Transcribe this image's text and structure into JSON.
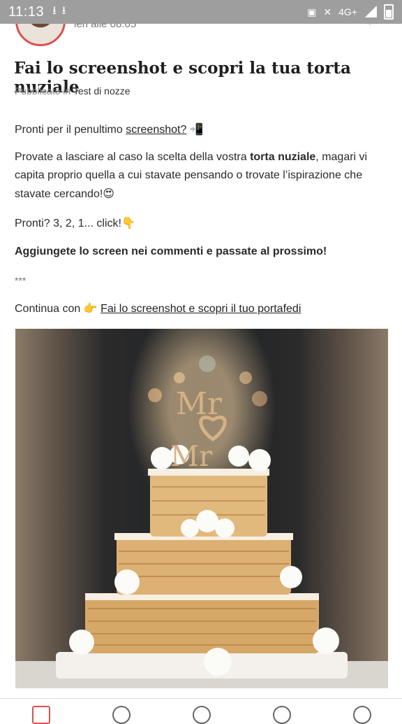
{
  "status_bar": {
    "time": "11:13",
    "network": "4G+",
    "left_icons": [
      "download-icon",
      "download-icon"
    ],
    "right_icons": [
      "nfc-icon",
      "mute-icon",
      "signal-icon",
      "battery-icon"
    ]
  },
  "post": {
    "time": "ieri alle 08:05",
    "title": "Fai lo screenshot e scopri la tua torta nuziale",
    "published_prefix": "Pubblicato in",
    "category": "Test di nozze",
    "p1_text": "Pronti per il penultimo ",
    "p1_link": "screenshot?",
    "p1_emoji": "📲",
    "p2_before": "Provate a lasciare al caso la scelta della vostra ",
    "p2_bold": "torta nuziale",
    "p2_after": ", magari vi capita proprio quella a cui stavate pensando o trovate l’ispirazione che stavate cercando!",
    "p2_emoji": "😍",
    "p3_text": "Pronti? 3, 2, 1... click!",
    "p3_emoji": "👇",
    "p4_text": "Aggiungete lo screen nei commenti e passate al prossimo!",
    "p5_text": "***",
    "p6_text": "Continua con ",
    "p6_emoji": "👉",
    "p6_link": "Fai lo screenshot e scopri il tuo portafedi"
  },
  "photo": {
    "topper_line1": "Mr",
    "topper_line2": "Mr"
  },
  "bottom_nav": {
    "items": [
      "nav-home",
      "nav-search",
      "nav-community",
      "nav-messages",
      "nav-profile"
    ]
  },
  "colors": {
    "accent": "#d9534f",
    "status_bar": "#9e9e9e"
  }
}
